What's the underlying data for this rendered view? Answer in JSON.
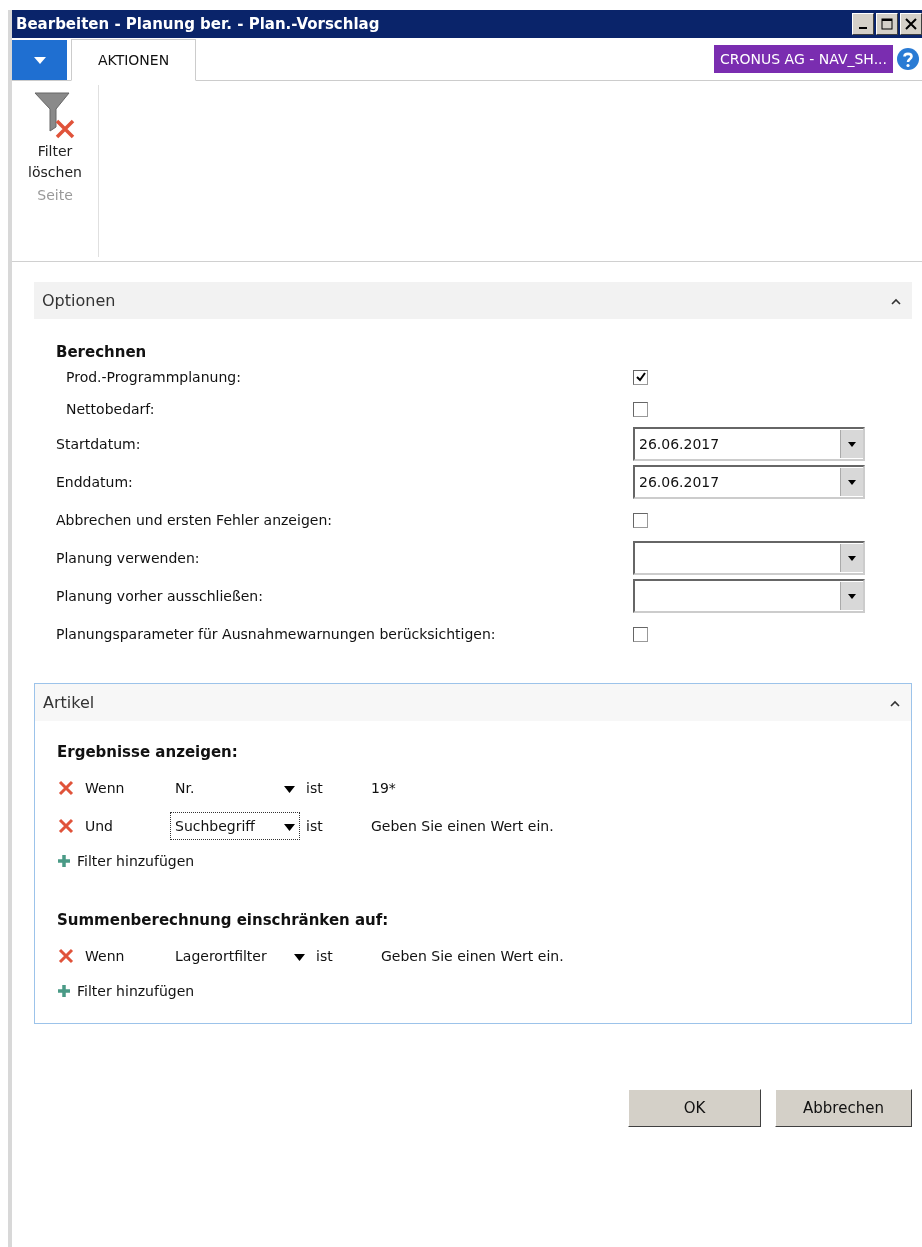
{
  "window": {
    "title": "Bearbeiten - Planung ber. - Plan.-Vorschlag"
  },
  "ribbon": {
    "tabs": [
      {
        "label": "AKTIONEN",
        "selected": true
      }
    ],
    "company": "CRONUS AG - NAV_SH...",
    "actions": [
      {
        "label": "Filter löschen"
      }
    ],
    "group_label": "Seite"
  },
  "options": {
    "title": "Optionen",
    "expanded": true,
    "groups": [
      {
        "heading": "Berechnen",
        "children": [
          {
            "kind": "checkbox",
            "label": "Prod.-Programmplanung:",
            "checked": true
          },
          {
            "kind": "checkbox",
            "label": "Nettobedarf:",
            "checked": false
          }
        ]
      }
    ],
    "fields": [
      {
        "kind": "date",
        "label": "Startdatum:",
        "value": "26.06.2017"
      },
      {
        "kind": "date",
        "label": "Enddatum:",
        "value": "26.06.2017"
      },
      {
        "kind": "checkbox",
        "label": "Abbrechen und ersten Fehler anzeigen:",
        "checked": false
      },
      {
        "kind": "dropdown",
        "label": "Planung verwenden:"
      },
      {
        "kind": "dropdown",
        "label": "Planung vorher ausschließen:"
      },
      {
        "kind": "checkbox",
        "label": "Planungsparameter für Ausnahmewarnungen berücksichtigen:",
        "checked": false
      }
    ]
  },
  "article": {
    "title": "Artikel",
    "expanded": true,
    "sections": [
      {
        "heading": "Ergebnisse anzeigen:",
        "filters": [
          {
            "op": "Wenn",
            "field": "Nr.",
            "focused": false,
            "relation": "ist",
            "value": "19*"
          },
          {
            "op": "Und",
            "field": "Suchbegriff",
            "focused": true,
            "relation": "ist",
            "placeholder": "Geben Sie einen Wert ein."
          }
        ],
        "add_label": "Filter hinzufügen"
      },
      {
        "heading": "Summenberechnung einschränken auf:",
        "filters": [
          {
            "op": "Wenn",
            "field": "Lagerortfilter",
            "focused": false,
            "relation": "ist",
            "placeholder": "Geben Sie einen Wert ein."
          }
        ],
        "add_label": "Filter hinzufügen"
      }
    ]
  },
  "buttons": [
    "OK",
    "Abbrechen"
  ]
}
